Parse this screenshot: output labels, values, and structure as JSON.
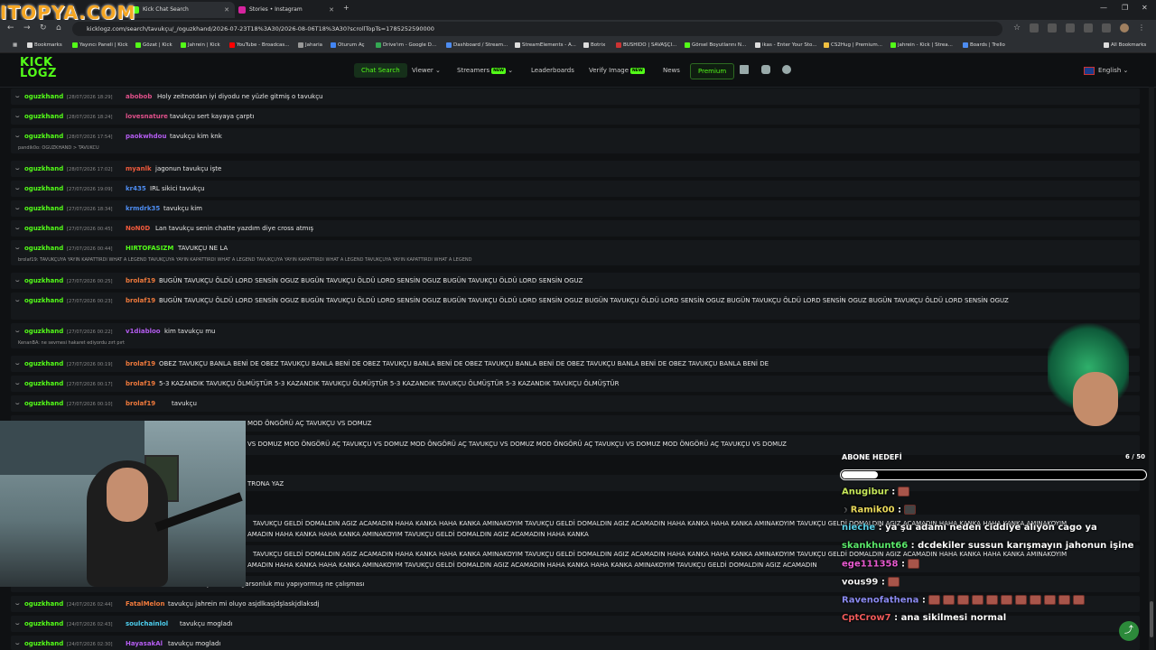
{
  "watermark": "ITOPYA.COM",
  "browser": {
    "tabs": [
      {
        "label": "Kick Chat Search",
        "favicon_color": "#53fc18"
      },
      {
        "label": "Stories • Instagram",
        "favicon_color": "#d6249f"
      }
    ],
    "url": "kicklogz.com/search/tavukçu/_/oguzkhand/2026-07-23T18%3A30/2026-08-06T18%3A30?scrollTopTs=1785252590000",
    "bookmarks": [
      "Bookmarks",
      "Yayıncı Paneli | Kick",
      "Gözat | Kick",
      "Jahrein | Kick",
      "YouTube - Broadcas...",
      "Jaharia",
      "Oturum Aç",
      "Drive'ım - Google D...",
      "Dashboard / Stream...",
      "StreamElements - A...",
      "Botrix",
      "BUSHIDO | SAVAŞÇI...",
      "Görsel Boyutlarını N...",
      "ikas - Enter Your Sto...",
      "CS2Hug | Premium...",
      "jahrein - Kick | Strea...",
      "Boards | Trello"
    ],
    "all_bookmarks": "All Bookmarks"
  },
  "site": {
    "logo_line1": "KICK",
    "logo_line2": "LOGZ",
    "nav": {
      "chat_search": "Chat Search",
      "viewer": "Viewer",
      "streamers": "Streamers",
      "leaderboards": "Leaderboards",
      "verify_image": "Verify Image",
      "news": "News",
      "premium": "Premium",
      "new_badge": "NEW"
    },
    "language": "English"
  },
  "messages": [
    {
      "channel": "oguzkhand",
      "ts": "[28/07/2026 18:29]",
      "user": "abobob",
      "user_color": "#e0508a",
      "msg": "Holy zeitnotdan iyi diyodu ne yüzle gitmiş o tavukçu"
    },
    {
      "channel": "oguzkhand",
      "ts": "[28/07/2026 18:24]",
      "user": "lovesnature",
      "user_color": "#e0508a",
      "msg": "tavukçu sert kayaya çarptı"
    },
    {
      "channel": "oguzkhand",
      "ts": "[28/07/2026 17:54]",
      "user": "paokwhdou",
      "user_color": "#b45cf0",
      "msg": "tavukçu kim knk",
      "reply": "pandik0o: OGUZKHAND > TAVUKCU"
    },
    {
      "channel": "oguzkhand",
      "ts": "[28/07/2026 17:02]",
      "user": "myanlk",
      "user_color": "#f05a3c",
      "msg": "jagonun tavukçu işte"
    },
    {
      "channel": "oguzkhand",
      "ts": "[27/07/2026 19:09]",
      "user": "kr435",
      "user_color": "#4d8cf0",
      "msg": "IRL sikici tavukçu"
    },
    {
      "channel": "oguzkhand",
      "ts": "[27/07/2026 18:34]",
      "user": "krmdrk35",
      "user_color": "#4d8cf0",
      "msg": "tavukçu kim"
    },
    {
      "channel": "oguzkhand",
      "ts": "[27/07/2026 00:45]",
      "user": "NoN0D",
      "user_color": "#f05a3c",
      "msg": "Lan tavukçu senin chatte yazdım diye cross atmış"
    },
    {
      "channel": "oguzkhand",
      "ts": "[27/07/2026 00:44]",
      "user": "HIRTOFASIZM",
      "user_color": "#53fc18",
      "msg": "TAVUKÇU NE LA",
      "reply": "brolaf19: TAVUKÇUYA YAYIN KAPATTIRDI WHAT A LEGEND TAVUKÇUYA YAYIN KAPATTIRDI WHAT A LEGEND TAVUKÇUYA YAYIN KAPATTIRDI WHAT A LEGEND TAVUKÇUYA YAYIN KAPATTIRDI WHAT A LEGEND"
    },
    {
      "channel": "oguzkhand",
      "ts": "[27/07/2026 00:25]",
      "user": "brolaf19",
      "user_color": "#f07a3c",
      "msg": "BUGÜN TAVUKÇU ÖLDÜ LORD SENSİN OGUZ BUGÜN TAVUKÇU ÖLDÜ LORD SENSİN OGUZ BUGÜN TAVUKÇU ÖLDÜ LORD SENSİN OGUZ"
    },
    {
      "channel": "oguzkhand",
      "ts": "[27/07/2026 00:23]",
      "user": "brolaf19",
      "user_color": "#f07a3c",
      "msg": "BUGÜN TAVUKÇU ÖLDÜ LORD SENSİN OGUZ BUGÜN TAVUKÇU ÖLDÜ LORD SENSİN OGUZ BUGÜN TAVUKÇU ÖLDÜ LORD SENSİN OGUZ BUGÜN TAVUKÇU ÖLDÜ LORD SENSİN OGUZ BUGÜN TAVUKÇU ÖLDÜ LORD SENSİN OGUZ BUGÜN TAVUKÇU ÖLDÜ LORD SENSİN OGUZ"
    },
    {
      "channel": "oguzkhand",
      "ts": "[27/07/2026 00:22]",
      "user": "v1diabloo",
      "user_color": "#b45cf0",
      "msg": "kim tavukçu mu",
      "reply": "KenanBA: ne sevmesi hakaret ediyordu zırt pırt"
    },
    {
      "channel": "oguzkhand",
      "ts": "[27/07/2026 00:19]",
      "user": "brolaf19",
      "user_color": "#f07a3c",
      "msg": "OBEZ TAVUKÇU BANLA BENİ DE OBEZ TAVUKÇU BANLA BENİ DE OBEZ TAVUKÇU BANLA BENİ DE OBEZ TAVUKÇU BANLA BENİ DE OBEZ TAVUKÇU BANLA BENİ DE OBEZ TAVUKÇU BANLA BENİ DE"
    },
    {
      "channel": "oguzkhand",
      "ts": "[27/07/2026 00:17]",
      "user": "brolaf19",
      "user_color": "#f07a3c",
      "msg": "5-3 KAZANDIK TAVUKÇU ÖLMÜŞTÜR 5-3 KAZANDIK TAVUKÇU ÖLMÜŞTÜR 5-3 KAZANDIK TAVUKÇU ÖLMÜŞTÜR 5-3 KAZANDIK TAVUKÇU ÖLMÜŞTÜR"
    },
    {
      "channel": "oguzkhand",
      "ts": "[27/07/2026 00:10]",
      "user": "brolaf19",
      "user_color": "#f07a3c",
      "msg": "tavukçu"
    }
  ],
  "partial_lines": [
    "UKÇU VS DOMUZ MOD ÖNGÖRÜ AÇ TAVUKÇU VS DOMUZ",
    "VS DOMUZ MOD ÖNGÖRÜ AÇ TAVUKÇU VS DOMUZ MOD ÖNGÖRÜ AÇ TAVUKÇU VS DOMUZ MOD ÖNGÖRÜ AÇ TAVUKÇU VS DOMUZ MOD ÖNGÖRÜ AÇ TAVUKÇU VS DOMUZ",
    "TRONA YAZ",
    "TAVUKÇU GELDİ DOMALDIN AGIZ ACAMADIN HAHA KANKA HAHA KANKA AMINAKOYIM TAVUKÇU GELDİ DOMALDIN AGIZ ACAMADIN HAHA KANKA HAHA KANKA AMINAKOYIM TAVUKÇU GELDİ DOMALDIN AGIZ ACAMADIN HAHA KANKA HAHA KANKA AMINAKOYIM",
    "AMADIN HAHA KANKA HAHA KANKA AMINAKOYIM TAVUKÇU GELDİ DOMALDIN AGIZ ACAMADIN HAHA KANKA",
    "TAVUKÇU GELDİ DOMALDIN AGIZ ACAMADIN HAHA KANKA HAHA KANKA AMINAKOYIM TAVUKÇU GELDİ DOMALDIN AGIZ ACAMADIN HAHA KANKA HAHA KANKA AMINAKOYIM TAVUKÇU GELDİ DOMALDIN AGIZ ACAMADIN HAHA KANKA HAHA KANKA AMINAKOYIM",
    "AMADIN HAHA KANKA HAHA KANKA AMINAKOYIM TAVUKÇU GELDİ DOMALDIN AGIZ ACAMADIN HAHA KANKA HAHA KANKA AMINAKOYIM TAVUKÇU GELDİ DOMALDIN AGIZ ACAMADIN",
    "tavukçu aramalı garsonluk mu yapıyormuş ne çalışması"
  ],
  "bottom_messages": [
    {
      "channel": "oguzkhand",
      "ts": "[24/07/2026 02:44]",
      "user": "FatalMelon",
      "user_color": "#f07a3c",
      "msg": "tavukçu jahrein mi oluyo asjdlkasjdşlaskjdlaksdj"
    },
    {
      "channel": "oguzkhand",
      "ts": "[24/07/2026 02:43]",
      "user": "soulchainlol",
      "user_color": "#4dd0f0",
      "msg": "tavukçu mogladı"
    },
    {
      "channel": "oguzkhand",
      "ts": "[24/07/2026 02:30]",
      "user": "HayasakAl",
      "user_color": "#b45cf0",
      "msg": "tavukçu mogladı"
    }
  ],
  "overlay": {
    "goal_title": "ABONE HEDEFİ",
    "goal_count": "6 / 50",
    "goal_progress": 0.12,
    "chat": [
      {
        "user": "Anugibur",
        "color": "#c7e85a",
        "text": ":",
        "emotes": 1
      },
      {
        "user": "Ramik00",
        "color": "#e8d85a",
        "text": ":",
        "emotes": 1
      },
      {
        "user": "nieche",
        "color": "#5ad0e8",
        "text": ": ya şu adamı neden ciddiye alıyon cago ya",
        "emotes": 0
      },
      {
        "user": "skankhunt66",
        "color": "#5ae86a",
        "text": ": dcdekiler sussun karışmayın jahonun işine",
        "emotes": 0
      },
      {
        "user": "ege111358",
        "color": "#e85ad0",
        "text": ":",
        "emotes": 1
      },
      {
        "user": "vous99",
        "color": "#f0f0f0",
        "text": ":",
        "emotes": 1
      },
      {
        "user": "Ravenofathena",
        "color": "#8a8af0",
        "text": ":",
        "emotes": 11
      },
      {
        "user": "CptCrow7",
        "color": "#f05a5a",
        "text": ": ana sikilmesi normal",
        "emotes": 0
      }
    ]
  }
}
